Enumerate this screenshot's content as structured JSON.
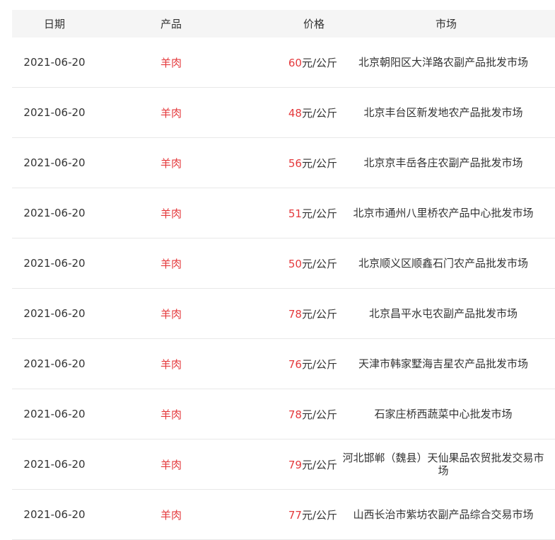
{
  "table": {
    "headers": {
      "date": "日期",
      "product": "产品",
      "price": "价格",
      "market": "市场"
    },
    "unit": "元/公斤",
    "rows": [
      {
        "date": "2021-06-20",
        "product": "羊肉",
        "price": "60",
        "unit": "元/公斤",
        "market": "北京朝阳区大洋路农副产品批发市场"
      },
      {
        "date": "2021-06-20",
        "product": "羊肉",
        "price": "48",
        "unit": "元/公斤",
        "market": "北京丰台区新发地农产品批发市场"
      },
      {
        "date": "2021-06-20",
        "product": "羊肉",
        "price": "56",
        "unit": "元/公斤",
        "market": "北京京丰岳各庄农副产品批发市场"
      },
      {
        "date": "2021-06-20",
        "product": "羊肉",
        "price": "51",
        "unit": "元/公斤",
        "market": "北京市通州八里桥农产品中心批发市场"
      },
      {
        "date": "2021-06-20",
        "product": "羊肉",
        "price": "50",
        "unit": "元/公斤",
        "market": "北京顺义区顺鑫石门农产品批发市场"
      },
      {
        "date": "2021-06-20",
        "product": "羊肉",
        "price": "78",
        "unit": "元/公斤",
        "market": "北京昌平水屯农副产品批发市场"
      },
      {
        "date": "2021-06-20",
        "product": "羊肉",
        "price": "76",
        "unit": "元/公斤",
        "market": "天津市韩家墅海吉星农产品批发市场"
      },
      {
        "date": "2021-06-20",
        "product": "羊肉",
        "price": "78",
        "unit": "元/公斤",
        "market": "石家庄桥西蔬菜中心批发市场"
      },
      {
        "date": "2021-06-20",
        "product": "羊肉",
        "price": "79",
        "unit": "元/公斤",
        "market": "河北邯郸（魏县）天仙果品农贸批发交易市场"
      },
      {
        "date": "2021-06-20",
        "product": "羊肉",
        "price": "77",
        "unit": "元/公斤",
        "market": "山西长治市紫坊农副产品综合交易市场"
      }
    ]
  }
}
